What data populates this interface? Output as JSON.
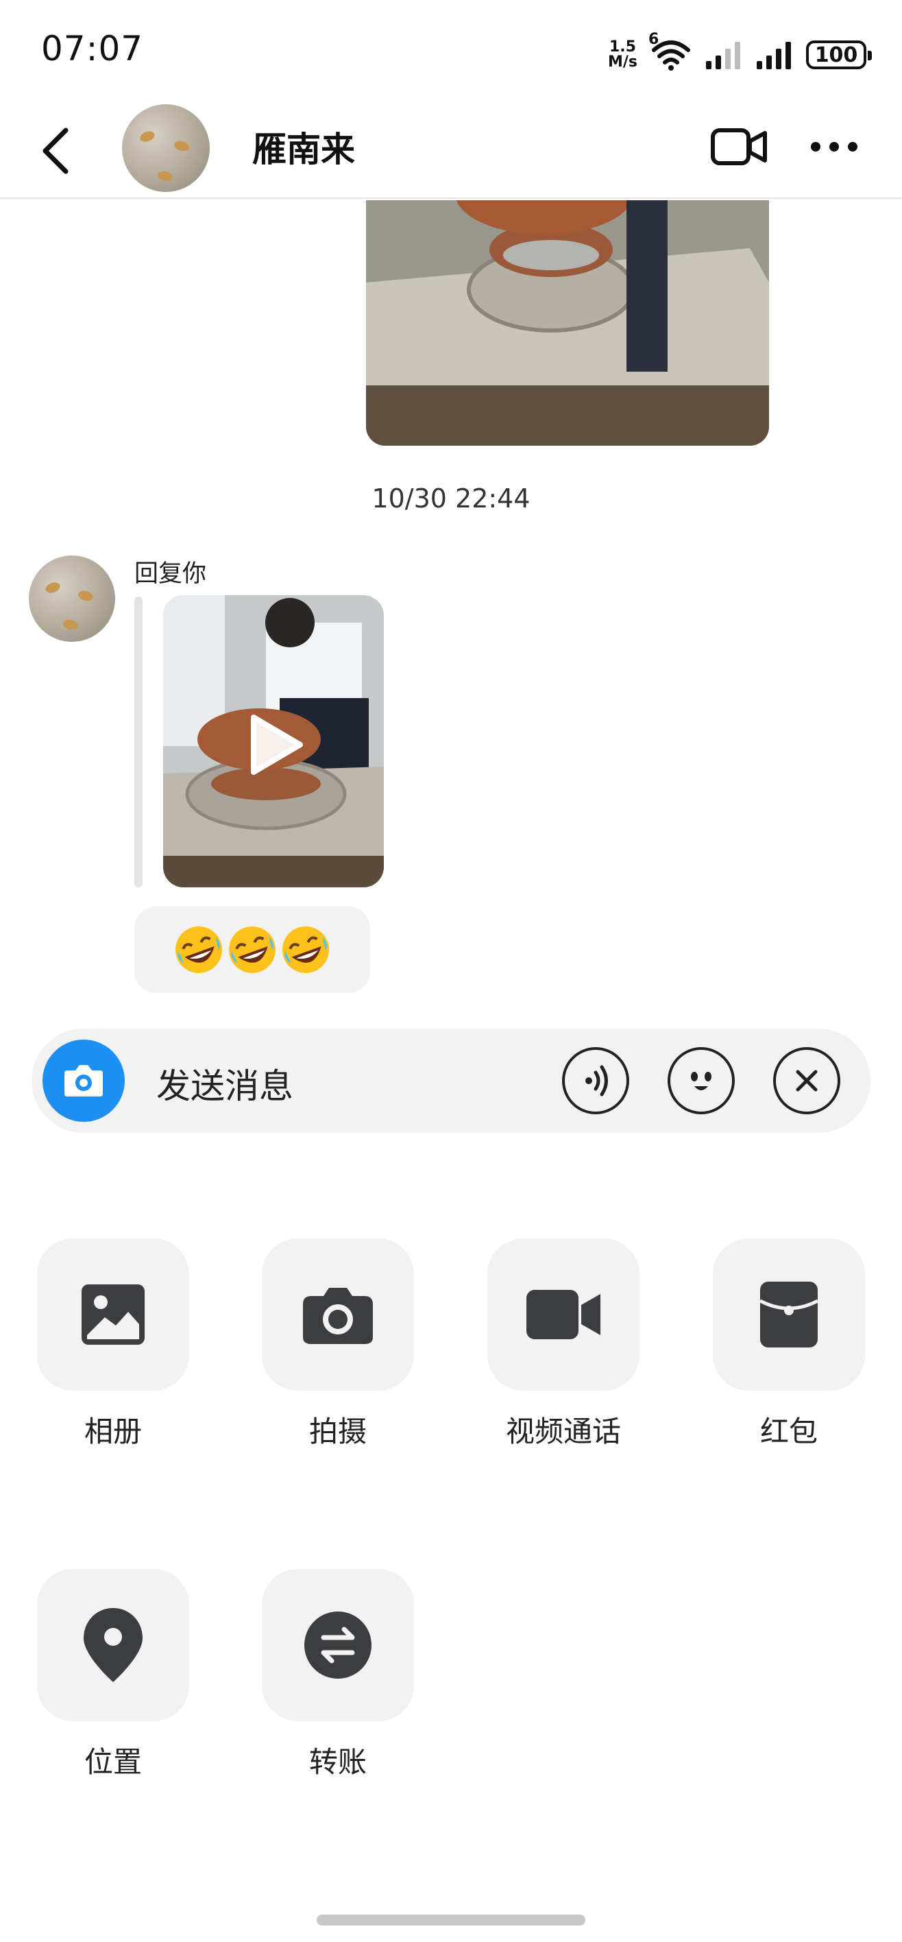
{
  "status_bar": {
    "time": "07:07",
    "net_speed_value": "1.5",
    "net_speed_unit": "M/s",
    "network_badge": "6",
    "battery": "100"
  },
  "header": {
    "title": "雁南来"
  },
  "messages": {
    "timestamp": "10/30 22:44",
    "reply_label": "回复你",
    "emoji_text": "🤣🤣🤣"
  },
  "input": {
    "placeholder": "发送消息"
  },
  "actions": [
    {
      "label": "相册",
      "icon": "image-icon"
    },
    {
      "label": "拍摄",
      "icon": "camera-icon"
    },
    {
      "label": "视频通话",
      "icon": "video-icon"
    },
    {
      "label": "红包",
      "icon": "red-packet-icon"
    },
    {
      "label": "位置",
      "icon": "location-icon"
    },
    {
      "label": "转账",
      "icon": "transfer-icon"
    }
  ],
  "colors": {
    "accent": "#1d8ff2",
    "icon_dark": "#3c3d40",
    "tile_bg": "#f2f2f2"
  }
}
